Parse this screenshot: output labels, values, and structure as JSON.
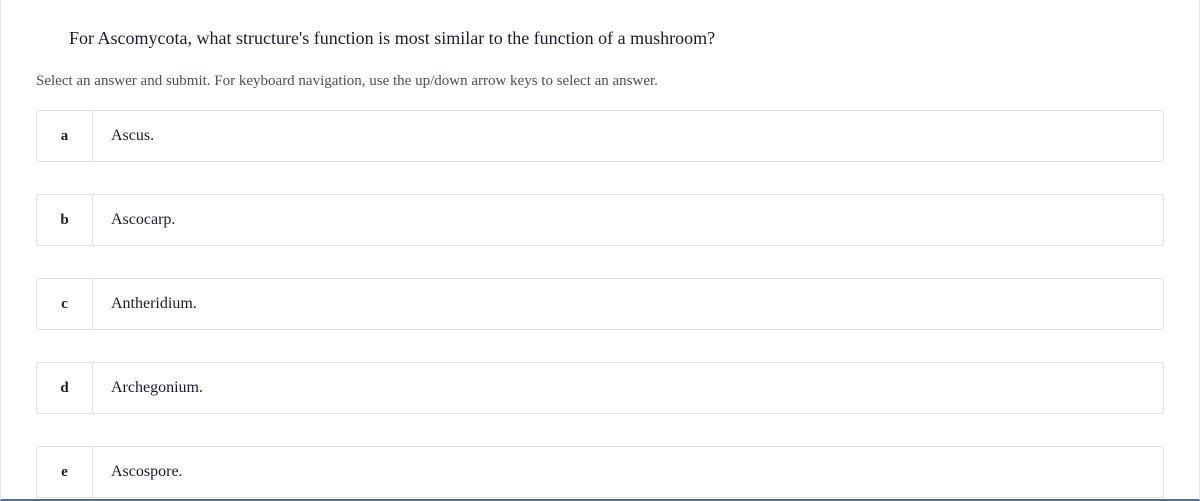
{
  "question": "For Ascomycota, what structure's function is most similar to the function of a mushroom?",
  "instruction": "Select an answer and submit. For keyboard navigation, use the up/down arrow keys to select an answer.",
  "options": [
    {
      "letter": "a",
      "text": "Ascus."
    },
    {
      "letter": "b",
      "text": "Ascocarp."
    },
    {
      "letter": "c",
      "text": "Antheridium."
    },
    {
      "letter": "d",
      "text": "Archegonium."
    },
    {
      "letter": "e",
      "text": "Ascospore."
    }
  ]
}
